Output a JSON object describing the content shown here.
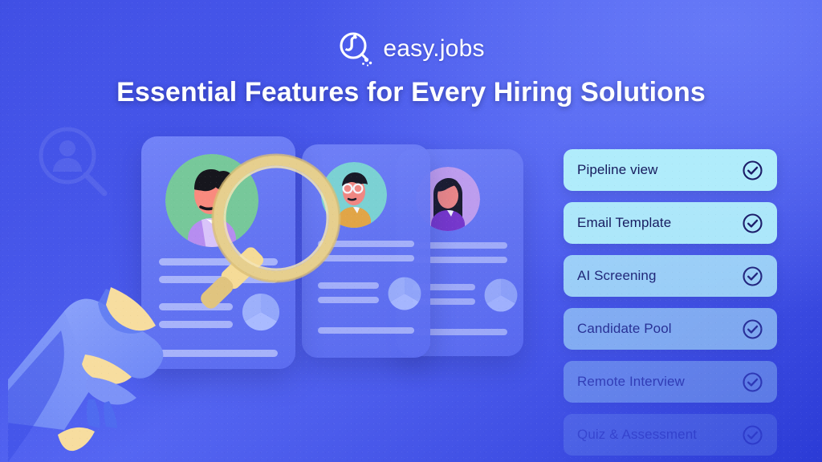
{
  "brand": {
    "name": "easy.jobs",
    "logo_icon": "magnifier-i-logo-icon"
  },
  "headline": "Essential Features for Every Hiring Solutions",
  "watermark_icon": "person-in-magnifier-icon",
  "colors": {
    "bg_gradient_from": "#3b49e0",
    "bg_gradient_mid": "#5566f2",
    "bg_gradient_to": "#2b3bd6",
    "card": "#6576f2",
    "pill_bg": "#b0ecfb",
    "pill_text": "#161a5c",
    "check_icon": "#1b1b66",
    "magnifier_gold": "#e6cf8e",
    "hand_blue": "#7d93f7"
  },
  "cards": [
    {
      "name": "candidate-card-front",
      "avatar": {
        "icon": "avatar-person-bun-icon",
        "bg": "#77c89a",
        "skin": "#f98a7e",
        "hair": "#16161d",
        "shirt": "#b68df0"
      }
    },
    {
      "name": "candidate-card-middle",
      "avatar": {
        "icon": "avatar-person-glasses-icon",
        "bg": "#7ed8d2",
        "skin": "#f98a7e",
        "hair": "#16161d",
        "shirt": "#e9a93f"
      }
    },
    {
      "name": "candidate-card-back",
      "avatar": {
        "icon": "avatar-person-long-hair-icon",
        "bg": "#c9a3ee",
        "skin": "#f98a7e",
        "hair": "#16161d",
        "shirt": "#7a34c9"
      }
    }
  ],
  "illustration": {
    "magnifier_icon": "magnifying-glass-icon",
    "hand_icon": "hand-holding-icon",
    "pie_icon": "pie-chart-icon"
  },
  "features": [
    {
      "label": "Pipeline view",
      "icon": "check-circle-icon"
    },
    {
      "label": "Email Template",
      "icon": "check-circle-icon"
    },
    {
      "label": "AI Screening",
      "icon": "check-circle-icon"
    },
    {
      "label": "Candidate Pool",
      "icon": "check-circle-icon"
    },
    {
      "label": "Remote Interview",
      "icon": "check-circle-icon"
    },
    {
      "label": "Quiz & Assessment",
      "icon": "check-circle-icon"
    }
  ]
}
